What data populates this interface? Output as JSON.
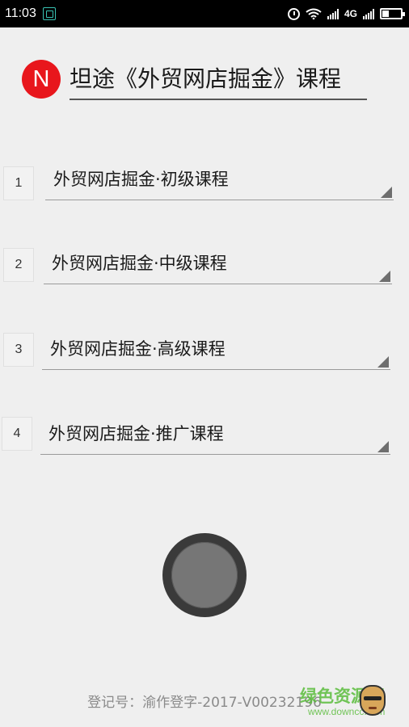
{
  "status_bar": {
    "time": "11:03",
    "network_type": "4G",
    "battery_level": 0.35,
    "icons": [
      "app-notification-icon",
      "alarm-icon",
      "wifi-icon",
      "signal-icon",
      "signal-icon",
      "battery-icon"
    ]
  },
  "header": {
    "logo_letter": "N",
    "title": "坦途《外贸网店掘金》课程",
    "logo_color": "#e8161c"
  },
  "courses": [
    {
      "number": "1",
      "label": "外贸网店掘金·初级课程"
    },
    {
      "number": "2",
      "label": "外贸网店掘金·中级课程"
    },
    {
      "number": "3",
      "label": "外贸网店掘金·高级课程"
    },
    {
      "number": "4",
      "label": "外贸网店掘金·推广课程"
    }
  ],
  "footer": {
    "registration": "登记号：渝作登字-2017-V00232196"
  },
  "watermark": {
    "text": "绿色资源网",
    "url": "www.downcc.com"
  }
}
